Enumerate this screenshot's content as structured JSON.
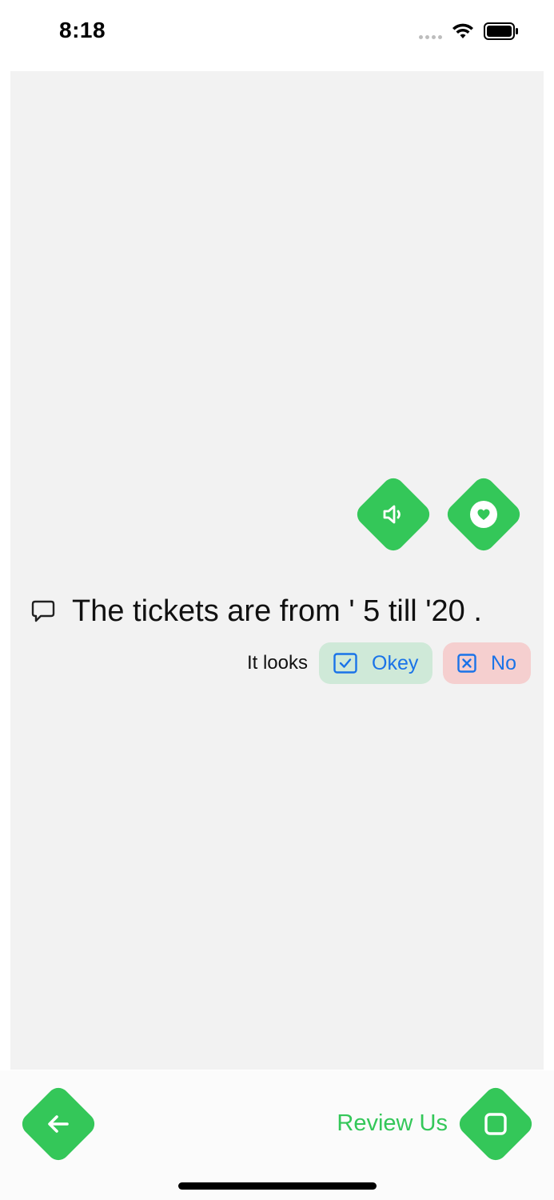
{
  "status_bar": {
    "time": "8:18"
  },
  "actions": {
    "speak_icon": "speaker-icon",
    "favorite_icon": "heart-icon"
  },
  "sentence": {
    "icon": "speech-bubble-icon",
    "text": "The tickets are from ' 5 till '20 ."
  },
  "feedback": {
    "label": "It looks",
    "okey_label": "Okey",
    "no_label": "No",
    "okey_icon": "checkbox-check-icon",
    "no_icon": "checkbox-x-icon"
  },
  "bottom_bar": {
    "back_icon": "arrow-left-icon",
    "review_label": "Review Us",
    "review_icon": "square-icon"
  },
  "colors": {
    "accent": "#34c759",
    "link": "#1a73e8",
    "okey_bg": "#cfe9d8",
    "no_bg": "#f5cfcf",
    "content_bg": "#f2f2f2"
  }
}
